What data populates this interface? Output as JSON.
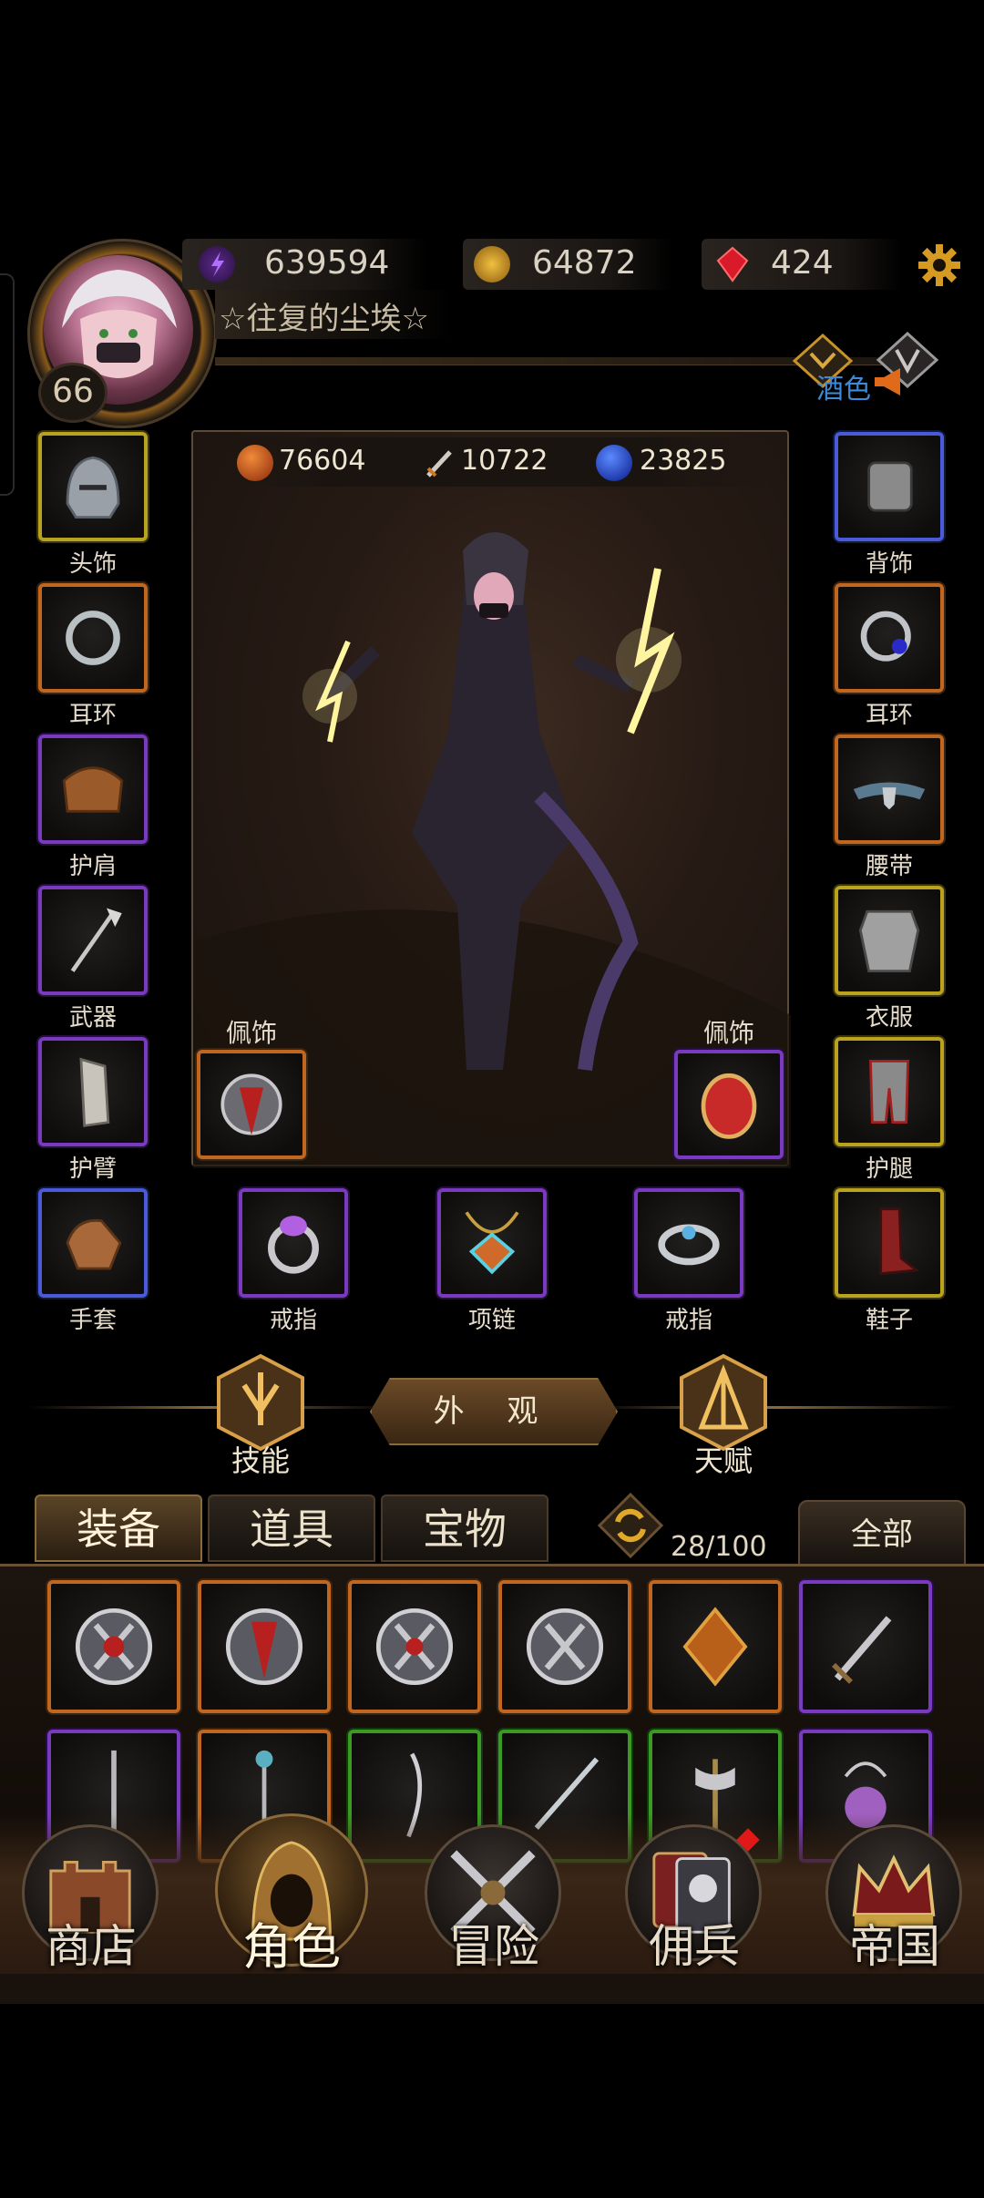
{
  "header": {
    "level": "66",
    "player_name": "☆往复的尘埃☆",
    "resources": [
      {
        "name": "energy",
        "value": "639594",
        "icon": "purple-lightning-icon"
      },
      {
        "name": "gold",
        "value": "64872",
        "icon": "gold-coin-icon"
      },
      {
        "name": "ruby",
        "value": "424",
        "icon": "red-gem-icon"
      }
    ],
    "notice_text": "酒色"
  },
  "stats": [
    {
      "value": "76604",
      "icon": "health-orb-icon",
      "color": "#d2481a"
    },
    {
      "value": "10722",
      "icon": "sword-attack-icon",
      "color": "#c8c0b0"
    },
    {
      "value": "23825",
      "icon": "mana-orb-icon",
      "color": "#2a4ad0"
    }
  ],
  "equipment": {
    "left": [
      {
        "label": "头饰",
        "rarity": "yellow"
      },
      {
        "label": "耳环",
        "rarity": "orange"
      },
      {
        "label": "护肩",
        "rarity": "purple"
      },
      {
        "label": "武器",
        "rarity": "purple"
      },
      {
        "label": "护臂",
        "rarity": "purple"
      },
      {
        "label": "手套",
        "rarity": "blue"
      }
    ],
    "right": [
      {
        "label": "背饰",
        "rarity": "blue"
      },
      {
        "label": "耳环",
        "rarity": "orange"
      },
      {
        "label": "腰带",
        "rarity": "orange"
      },
      {
        "label": "衣服",
        "rarity": "yellow"
      },
      {
        "label": "护腿",
        "rarity": "yellow"
      },
      {
        "label": "鞋子",
        "rarity": "yellow"
      }
    ],
    "bottom": [
      {
        "label": "戒指",
        "rarity": "purple"
      },
      {
        "label": "项链",
        "rarity": "purple"
      },
      {
        "label": "戒指",
        "rarity": "purple"
      }
    ],
    "accessories": [
      {
        "label": "佩饰",
        "rarity": "orange"
      },
      {
        "label": "佩饰",
        "rarity": "purple"
      }
    ]
  },
  "actions": {
    "skills_label": "技能",
    "appearance_label": "外 观",
    "talent_label": "天赋"
  },
  "inventory": {
    "tabs": [
      "装备",
      "道具",
      "宝物"
    ],
    "active_tab": "装备",
    "count": "28/100",
    "filter_label": "全部",
    "row1": [
      "orange",
      "orange",
      "orange",
      "orange",
      "orange",
      "purple"
    ],
    "row2": [
      "purple",
      "orange",
      "green",
      "green",
      "green",
      "purple"
    ]
  },
  "bottom_nav": [
    {
      "label": "商店",
      "icon": "castle-shop-icon"
    },
    {
      "label": "角色",
      "icon": "hooded-character-icon",
      "active": true
    },
    {
      "label": "冒险",
      "icon": "crossed-swords-icon"
    },
    {
      "label": "佣兵",
      "icon": "mercenary-cards-icon"
    },
    {
      "label": "帝国",
      "icon": "crown-icon"
    }
  ],
  "colors": {
    "orange": "#c0661e",
    "purple": "#7a3ac0",
    "yellow": "#b8a21e",
    "blue": "#4a5ad8",
    "green": "#3a9a22",
    "accent_gold": "#c8922a"
  }
}
